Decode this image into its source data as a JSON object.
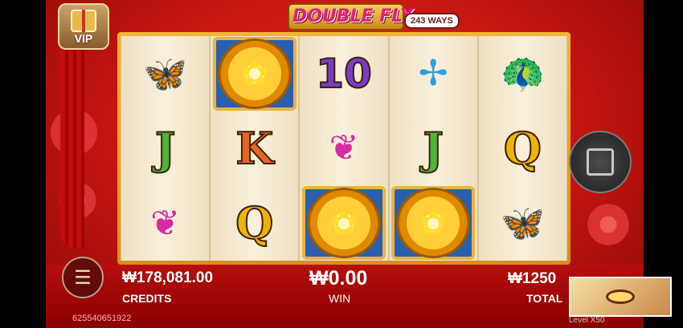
{
  "game": {
    "title": "DOUBLE FLY",
    "ways": "243 WAYS",
    "vip_label": "VIP"
  },
  "reels": [
    [
      "butterfly",
      "J",
      "ducks"
    ],
    [
      "lotus",
      "K",
      "Q"
    ],
    [
      "10",
      "ducks",
      "lotus"
    ],
    [
      "dragonfly",
      "J",
      "lotus"
    ],
    [
      "peacock",
      "Q",
      "butterfly"
    ]
  ],
  "hud": {
    "credits_value": "₩178,081.00",
    "credits_label": "CREDITS",
    "win_value": "₩0.00",
    "win_label": "WIN",
    "total_value": "₩1250",
    "total_label": "TOTAL",
    "session_id": "625540651922",
    "level_text": "Level  X50"
  },
  "controls": {
    "menu_icon": "hamburger-icon",
    "spin_icon": "stop-square-icon"
  },
  "colors": {
    "background": "#c4140f",
    "frame": "#e8a72a",
    "reel_bg": "#f4e7cc"
  }
}
